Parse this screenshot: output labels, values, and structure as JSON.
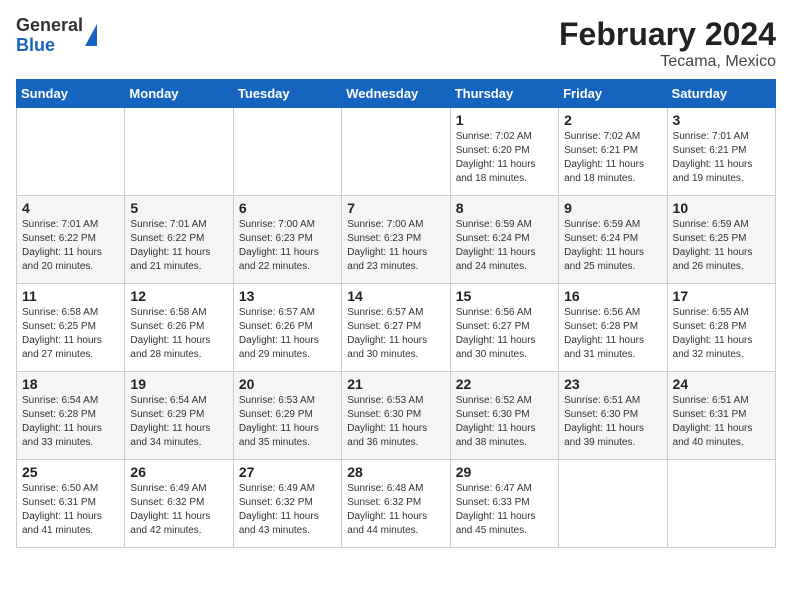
{
  "logo": {
    "line1": "General",
    "line2": "Blue"
  },
  "title": "February 2024",
  "subtitle": "Tecama, Mexico",
  "days_of_week": [
    "Sunday",
    "Monday",
    "Tuesday",
    "Wednesday",
    "Thursday",
    "Friday",
    "Saturday"
  ],
  "weeks": [
    [
      {
        "day": "",
        "info": ""
      },
      {
        "day": "",
        "info": ""
      },
      {
        "day": "",
        "info": ""
      },
      {
        "day": "",
        "info": ""
      },
      {
        "day": "1",
        "info": "Sunrise: 7:02 AM\nSunset: 6:20 PM\nDaylight: 11 hours and 18 minutes."
      },
      {
        "day": "2",
        "info": "Sunrise: 7:02 AM\nSunset: 6:21 PM\nDaylight: 11 hours and 18 minutes."
      },
      {
        "day": "3",
        "info": "Sunrise: 7:01 AM\nSunset: 6:21 PM\nDaylight: 11 hours and 19 minutes."
      }
    ],
    [
      {
        "day": "4",
        "info": "Sunrise: 7:01 AM\nSunset: 6:22 PM\nDaylight: 11 hours and 20 minutes."
      },
      {
        "day": "5",
        "info": "Sunrise: 7:01 AM\nSunset: 6:22 PM\nDaylight: 11 hours and 21 minutes."
      },
      {
        "day": "6",
        "info": "Sunrise: 7:00 AM\nSunset: 6:23 PM\nDaylight: 11 hours and 22 minutes."
      },
      {
        "day": "7",
        "info": "Sunrise: 7:00 AM\nSunset: 6:23 PM\nDaylight: 11 hours and 23 minutes."
      },
      {
        "day": "8",
        "info": "Sunrise: 6:59 AM\nSunset: 6:24 PM\nDaylight: 11 hours and 24 minutes."
      },
      {
        "day": "9",
        "info": "Sunrise: 6:59 AM\nSunset: 6:24 PM\nDaylight: 11 hours and 25 minutes."
      },
      {
        "day": "10",
        "info": "Sunrise: 6:59 AM\nSunset: 6:25 PM\nDaylight: 11 hours and 26 minutes."
      }
    ],
    [
      {
        "day": "11",
        "info": "Sunrise: 6:58 AM\nSunset: 6:25 PM\nDaylight: 11 hours and 27 minutes."
      },
      {
        "day": "12",
        "info": "Sunrise: 6:58 AM\nSunset: 6:26 PM\nDaylight: 11 hours and 28 minutes."
      },
      {
        "day": "13",
        "info": "Sunrise: 6:57 AM\nSunset: 6:26 PM\nDaylight: 11 hours and 29 minutes."
      },
      {
        "day": "14",
        "info": "Sunrise: 6:57 AM\nSunset: 6:27 PM\nDaylight: 11 hours and 30 minutes."
      },
      {
        "day": "15",
        "info": "Sunrise: 6:56 AM\nSunset: 6:27 PM\nDaylight: 11 hours and 30 minutes."
      },
      {
        "day": "16",
        "info": "Sunrise: 6:56 AM\nSunset: 6:28 PM\nDaylight: 11 hours and 31 minutes."
      },
      {
        "day": "17",
        "info": "Sunrise: 6:55 AM\nSunset: 6:28 PM\nDaylight: 11 hours and 32 minutes."
      }
    ],
    [
      {
        "day": "18",
        "info": "Sunrise: 6:54 AM\nSunset: 6:28 PM\nDaylight: 11 hours and 33 minutes."
      },
      {
        "day": "19",
        "info": "Sunrise: 6:54 AM\nSunset: 6:29 PM\nDaylight: 11 hours and 34 minutes."
      },
      {
        "day": "20",
        "info": "Sunrise: 6:53 AM\nSunset: 6:29 PM\nDaylight: 11 hours and 35 minutes."
      },
      {
        "day": "21",
        "info": "Sunrise: 6:53 AM\nSunset: 6:30 PM\nDaylight: 11 hours and 36 minutes."
      },
      {
        "day": "22",
        "info": "Sunrise: 6:52 AM\nSunset: 6:30 PM\nDaylight: 11 hours and 38 minutes."
      },
      {
        "day": "23",
        "info": "Sunrise: 6:51 AM\nSunset: 6:30 PM\nDaylight: 11 hours and 39 minutes."
      },
      {
        "day": "24",
        "info": "Sunrise: 6:51 AM\nSunset: 6:31 PM\nDaylight: 11 hours and 40 minutes."
      }
    ],
    [
      {
        "day": "25",
        "info": "Sunrise: 6:50 AM\nSunset: 6:31 PM\nDaylight: 11 hours and 41 minutes."
      },
      {
        "day": "26",
        "info": "Sunrise: 6:49 AM\nSunset: 6:32 PM\nDaylight: 11 hours and 42 minutes."
      },
      {
        "day": "27",
        "info": "Sunrise: 6:49 AM\nSunset: 6:32 PM\nDaylight: 11 hours and 43 minutes."
      },
      {
        "day": "28",
        "info": "Sunrise: 6:48 AM\nSunset: 6:32 PM\nDaylight: 11 hours and 44 minutes."
      },
      {
        "day": "29",
        "info": "Sunrise: 6:47 AM\nSunset: 6:33 PM\nDaylight: 11 hours and 45 minutes."
      },
      {
        "day": "",
        "info": ""
      },
      {
        "day": "",
        "info": ""
      }
    ]
  ]
}
